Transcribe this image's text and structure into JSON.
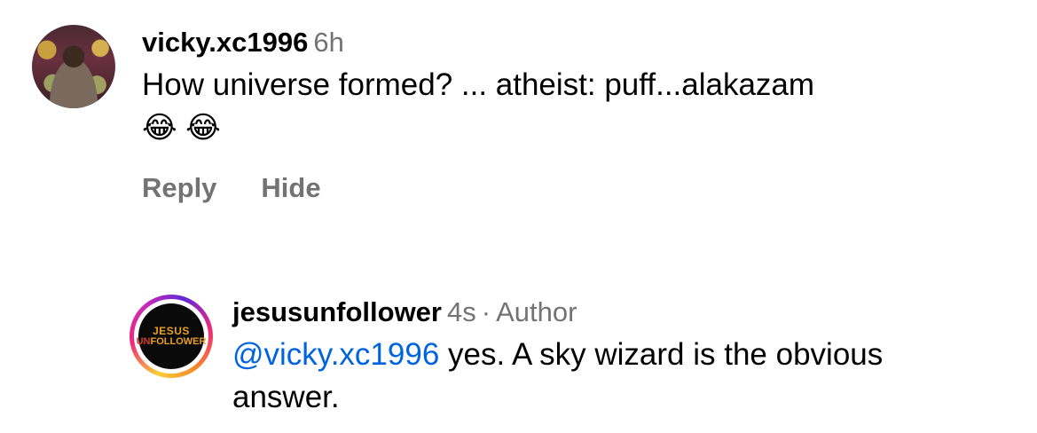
{
  "comments": [
    {
      "username": "vicky.xc1996",
      "time": "6h",
      "text": "How universe formed? ... atheist: puff...alakazam",
      "emojis": "😂 😂",
      "actions": {
        "reply": "Reply",
        "hide": "Hide"
      }
    },
    {
      "username": "jesusunfollower",
      "time": "4s",
      "separator": "·",
      "badge": "Author",
      "mention": "@vicky.xc1996",
      "text": " yes. A sky wizard is the obvious answer.",
      "logo": {
        "top": "JESUS",
        "bottom_red": "UN",
        "bottom": "FOLLOWER"
      }
    }
  ],
  "colors": {
    "secondary": "#737373",
    "mention": "#0064e0"
  }
}
